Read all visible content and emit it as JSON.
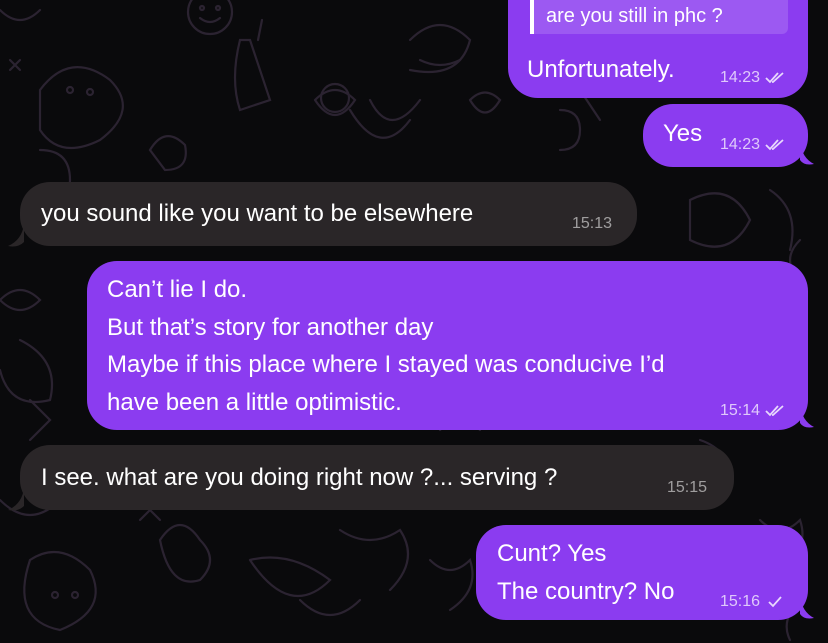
{
  "chat": {
    "reply_quote": "are you still in phc ?",
    "messages": [
      {
        "direction": "outgoing",
        "text": "Unfortunately.",
        "time": "14:23",
        "status": "read"
      },
      {
        "direction": "outgoing",
        "text": "Yes",
        "time": "14:23",
        "status": "read"
      },
      {
        "direction": "incoming",
        "text": "you sound like you want to be elsewhere",
        "time": "15:13"
      },
      {
        "direction": "outgoing",
        "text": "Can’t lie I do.\nBut that’s story for another day\nMaybe if this place where I stayed was conducive I’d\nhave been a little optimistic.",
        "time": "15:14",
        "status": "read"
      },
      {
        "direction": "incoming",
        "text": "I see. what are you doing right now ?... serving ?",
        "time": "15:15"
      },
      {
        "direction": "outgoing",
        "text": "Cunt? Yes\nThe country? No",
        "time": "15:16",
        "status": "sent"
      }
    ]
  },
  "colors": {
    "background": "#0a0a0c",
    "outgoing_bubble": "#8b3cf0",
    "incoming_bubble": "#2a2628",
    "doodle_stroke": "#2a2230"
  },
  "icons": {
    "read": "double-check-icon",
    "sent": "single-check-icon"
  }
}
